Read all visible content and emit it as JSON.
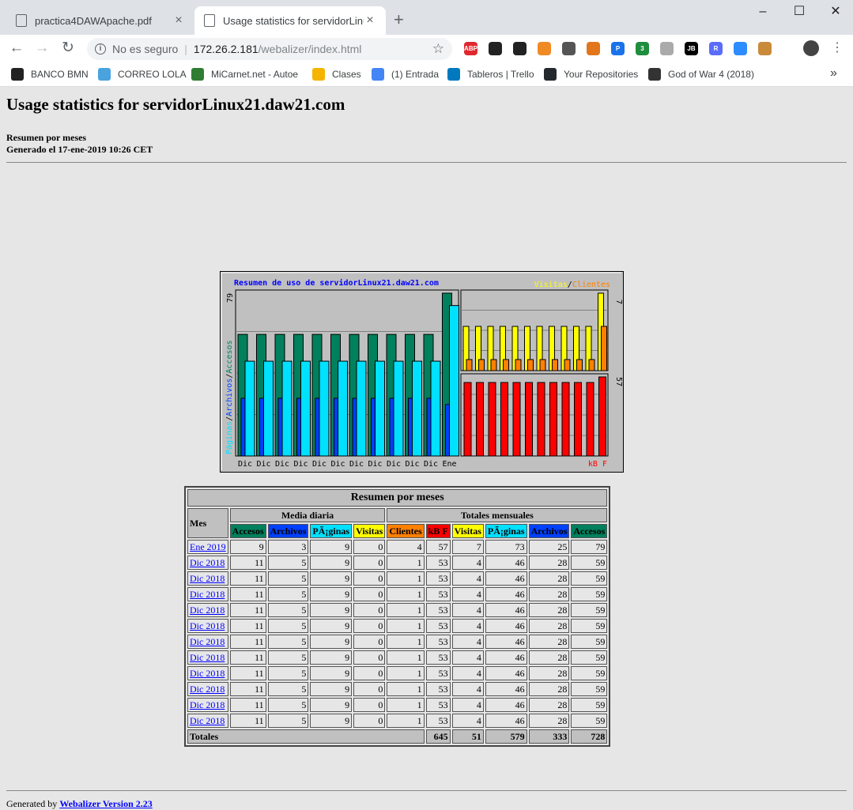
{
  "browser": {
    "tabs": [
      {
        "title": "practica4DAWApache.pdf",
        "close": "×"
      },
      {
        "title": "Usage statistics for servidorLinux21.daw21.com",
        "close": "×"
      }
    ],
    "new_tab": "+",
    "window_controls": {
      "minimize": "–",
      "maximize": "☐",
      "close": "✕"
    },
    "nav": {
      "back": "←",
      "forward": "→",
      "reload": "↻"
    },
    "address": {
      "security": "No es seguro",
      "host": "172.26.2.181",
      "path": "/webalizer/index.html",
      "star": "☆"
    },
    "extensions": [
      {
        "name": "adblock-icon",
        "label": "ABP",
        "color": "#e0282d"
      },
      {
        "name": "gnome-icon",
        "label": "",
        "color": "#222222"
      },
      {
        "name": "extension-icon",
        "label": "",
        "color": "#222222"
      },
      {
        "name": "blocker-icon",
        "label": "",
        "color": "#f08a24"
      },
      {
        "name": "lock-icon",
        "label": "",
        "color": "#555555"
      },
      {
        "name": "metamask-icon",
        "label": "",
        "color": "#e2761b"
      },
      {
        "name": "pdf-icon",
        "label": "P",
        "color": "#1a73e8"
      },
      {
        "name": "green-extension-icon",
        "label": "3",
        "color": "#1e8e3e"
      },
      {
        "name": "shield-icon",
        "label": "",
        "color": "#aaaaaa"
      },
      {
        "name": "jetbrains-icon",
        "label": "JB",
        "color": "#000000"
      },
      {
        "name": "r-extension-icon",
        "label": "R",
        "color": "#5b6cf9"
      },
      {
        "name": "zoom-icon",
        "label": "",
        "color": "#2d8cff"
      },
      {
        "name": "cookie-icon",
        "label": "",
        "color": "#c98a3a"
      }
    ],
    "menu": "⋮",
    "bookmarks": [
      {
        "label": "BANCO BMN",
        "color": "#222222"
      },
      {
        "label": "CORREO LOLA",
        "color": "#4aa3df"
      },
      {
        "label": "MiCarnet.net - Autoe",
        "color": "#2e7d32"
      },
      {
        "label": "Clases",
        "color": "#f4b400"
      },
      {
        "label": "(1) Entrada",
        "color": "#4285f4"
      },
      {
        "label": "Tableros | Trello",
        "color": "#0079bf"
      },
      {
        "label": "Your Repositories",
        "color": "#24292e"
      },
      {
        "label": "God of War 4 (2018)",
        "color": "#333333"
      }
    ],
    "more_bookmarks": "»"
  },
  "page": {
    "title": "Usage statistics for servidorLinux21.daw21.com",
    "subtitle": "Resumen por meses",
    "generated": "Generado el 17-ene-2019 10:26 CET"
  },
  "colors": {
    "accesos": "#00805c",
    "archivos": "#0040ff",
    "paginas": "#00e0ff",
    "visitas": "#ffff00",
    "clientes": "#ff8000",
    "kbf": "#ff0000"
  },
  "chart_data": {
    "type": "bar",
    "title": "Resumen de uso de servidorLinux21.daw21.com",
    "categories": [
      "Dic",
      "Dic",
      "Dic",
      "Dic",
      "Dic",
      "Dic",
      "Dic",
      "Dic",
      "Dic",
      "Dic",
      "Dic",
      "Ene"
    ],
    "left_axis_label_parts": [
      "Páginas",
      "/",
      "Archivos",
      "/",
      "Accesos"
    ],
    "left_max_label": "79",
    "right_top_legend": [
      "Visitas",
      "/",
      "Clientes"
    ],
    "right_top_max_label": "7",
    "right_bottom_max_label": "57",
    "right_bottom_legend": "kB F",
    "series": [
      {
        "name": "Accesos",
        "values": [
          59,
          59,
          59,
          59,
          59,
          59,
          59,
          59,
          59,
          59,
          59,
          79
        ]
      },
      {
        "name": "Páginas",
        "values": [
          46,
          46,
          46,
          46,
          46,
          46,
          46,
          46,
          46,
          46,
          46,
          73
        ]
      },
      {
        "name": "Archivos",
        "values": [
          28,
          28,
          28,
          28,
          28,
          28,
          28,
          28,
          28,
          28,
          28,
          25
        ]
      },
      {
        "name": "Visitas",
        "values": [
          4,
          4,
          4,
          4,
          4,
          4,
          4,
          4,
          4,
          4,
          4,
          7
        ]
      },
      {
        "name": "Clientes",
        "values": [
          1,
          1,
          1,
          1,
          1,
          1,
          1,
          1,
          1,
          1,
          1,
          4
        ]
      },
      {
        "name": "kB F",
        "values": [
          53,
          53,
          53,
          53,
          53,
          53,
          53,
          53,
          53,
          53,
          53,
          57
        ]
      }
    ]
  },
  "table": {
    "title": "Resumen por meses",
    "mes_header": "Mes",
    "daily_header": "Media diaria",
    "monthly_header": "Totales mensuales",
    "daily_columns": [
      "Accesos",
      "Archivos",
      "PÃ¡ginas",
      "Visitas"
    ],
    "monthly_columns": [
      "Clientes",
      "kB F",
      "Visitas",
      "PÃ¡ginas",
      "Archivos",
      "Accesos"
    ],
    "rows": [
      {
        "month": "Ene 2019",
        "values": [
          "9",
          "3",
          "9",
          "0",
          "4",
          "57",
          "7",
          "73",
          "25",
          "79"
        ]
      },
      {
        "month": "Dic 2018",
        "values": [
          "11",
          "5",
          "9",
          "0",
          "1",
          "53",
          "4",
          "46",
          "28",
          "59"
        ]
      },
      {
        "month": "Dic 2018",
        "values": [
          "11",
          "5",
          "9",
          "0",
          "1",
          "53",
          "4",
          "46",
          "28",
          "59"
        ]
      },
      {
        "month": "Dic 2018",
        "values": [
          "11",
          "5",
          "9",
          "0",
          "1",
          "53",
          "4",
          "46",
          "28",
          "59"
        ]
      },
      {
        "month": "Dic 2018",
        "values": [
          "11",
          "5",
          "9",
          "0",
          "1",
          "53",
          "4",
          "46",
          "28",
          "59"
        ]
      },
      {
        "month": "Dic 2018",
        "values": [
          "11",
          "5",
          "9",
          "0",
          "1",
          "53",
          "4",
          "46",
          "28",
          "59"
        ]
      },
      {
        "month": "Dic 2018",
        "values": [
          "11",
          "5",
          "9",
          "0",
          "1",
          "53",
          "4",
          "46",
          "28",
          "59"
        ]
      },
      {
        "month": "Dic 2018",
        "values": [
          "11",
          "5",
          "9",
          "0",
          "1",
          "53",
          "4",
          "46",
          "28",
          "59"
        ]
      },
      {
        "month": "Dic 2018",
        "values": [
          "11",
          "5",
          "9",
          "0",
          "1",
          "53",
          "4",
          "46",
          "28",
          "59"
        ]
      },
      {
        "month": "Dic 2018",
        "values": [
          "11",
          "5",
          "9",
          "0",
          "1",
          "53",
          "4",
          "46",
          "28",
          "59"
        ]
      },
      {
        "month": "Dic 2018",
        "values": [
          "11",
          "5",
          "9",
          "0",
          "1",
          "53",
          "4",
          "46",
          "28",
          "59"
        ]
      },
      {
        "month": "Dic 2018",
        "values": [
          "11",
          "5",
          "9",
          "0",
          "1",
          "53",
          "4",
          "46",
          "28",
          "59"
        ]
      }
    ],
    "totals_label": "Totales",
    "totals": [
      "645",
      "51",
      "579",
      "333",
      "728"
    ]
  },
  "footer": {
    "prefix": "Generated by ",
    "link": "Webalizer Version 2.23"
  }
}
